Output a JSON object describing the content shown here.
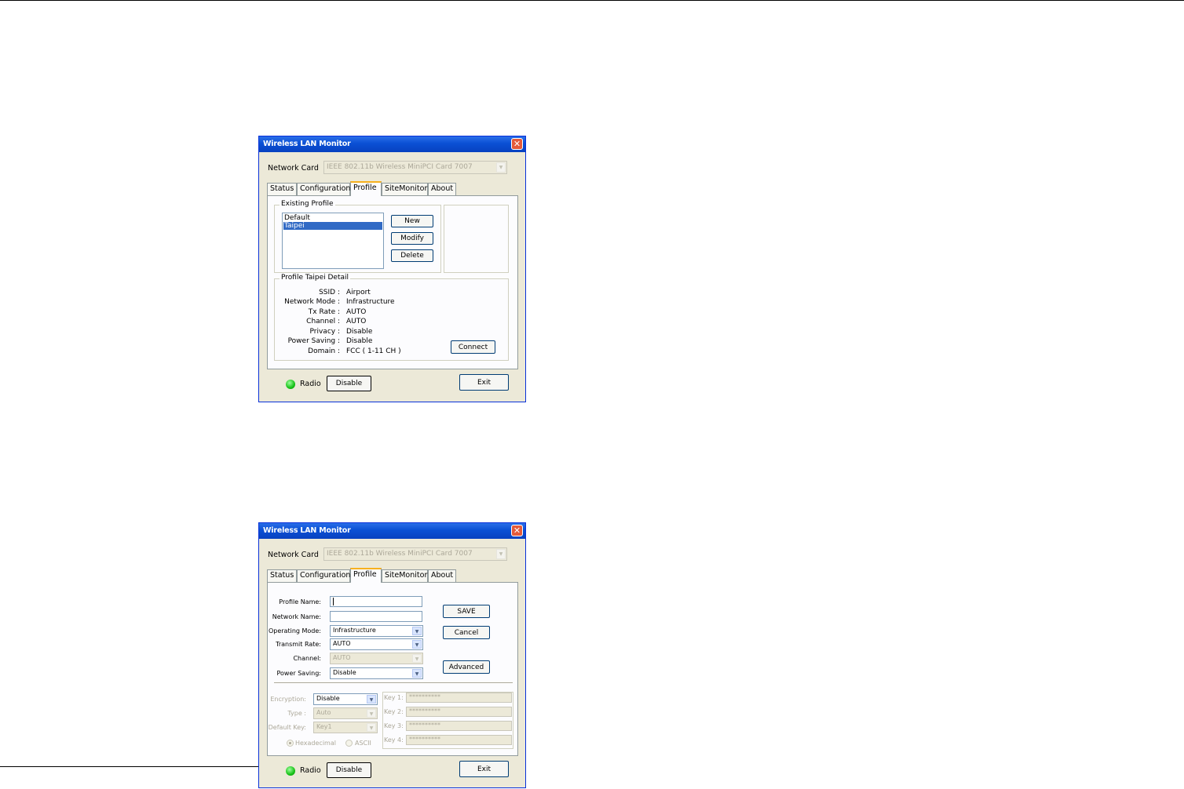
{
  "window_title": "Wireless LAN Monitor",
  "close_glyph": "✕",
  "network_card": {
    "label": "Network Card",
    "value": "IEEE 802.11b Wireless MiniPCI Card 7007"
  },
  "tabs": [
    "Status",
    "Configuration",
    "Profile",
    "SiteMonitor",
    "About"
  ],
  "dropdown_glyph": "▼",
  "profile_list": {
    "group_label": "Existing Profile",
    "items": [
      "Default",
      "Taipei"
    ],
    "selected": "Taipei",
    "buttons": {
      "new": "New",
      "modify": "Modify",
      "delete": "Delete"
    }
  },
  "profile_detail": {
    "group_label": "Profile   Taipei   Detail",
    "rows": [
      {
        "label": "SSID :",
        "value": "Airport"
      },
      {
        "label": "Network Mode :",
        "value": "Infrastructure"
      },
      {
        "label": "Tx Rate :",
        "value": "AUTO"
      },
      {
        "label": "Channel :",
        "value": "AUTO"
      },
      {
        "label": "Privacy :",
        "value": "Disable"
      },
      {
        "label": "Power Saving :",
        "value": "Disable"
      },
      {
        "label": "Domain :",
        "value": "FCC ( 1-11 CH )"
      }
    ],
    "connect_label": "Connect"
  },
  "footer": {
    "radio_label": "Radio",
    "radio_button": "Disable",
    "exit_button": "Exit",
    "radio_status_color": "#17c117"
  },
  "edit_form": {
    "profile_name": {
      "label": "Profile Name:",
      "value": ""
    },
    "network_name": {
      "label": "Network Name:",
      "value": ""
    },
    "operating_mode": {
      "label": "Operating Mode:",
      "value": "Infrastructure"
    },
    "transmit_rate": {
      "label": "Transmit Rate:",
      "value": "AUTO"
    },
    "channel": {
      "label": "Channel:",
      "value": "AUTO"
    },
    "power_saving": {
      "label": "Power Saving:",
      "value": "Disable"
    },
    "save_button": "SAVE",
    "cancel_button": "Cancel",
    "advanced_button": "Advanced",
    "encryption": {
      "label": "Encryption:",
      "value": "Disable"
    },
    "type": {
      "label": "Type :",
      "value": "Auto"
    },
    "default_key": {
      "label": "Default Key:",
      "value": "Key1"
    },
    "format_options": [
      "Hexadecimal",
      "ASCII"
    ],
    "format_selected": "Hexadecimal",
    "keys": [
      {
        "label": "Key 1:",
        "value": "**********"
      },
      {
        "label": "Key 2:",
        "value": "**********"
      },
      {
        "label": "Key 3:",
        "value": "**********"
      },
      {
        "label": "Key 4:",
        "value": "**********"
      }
    ]
  }
}
